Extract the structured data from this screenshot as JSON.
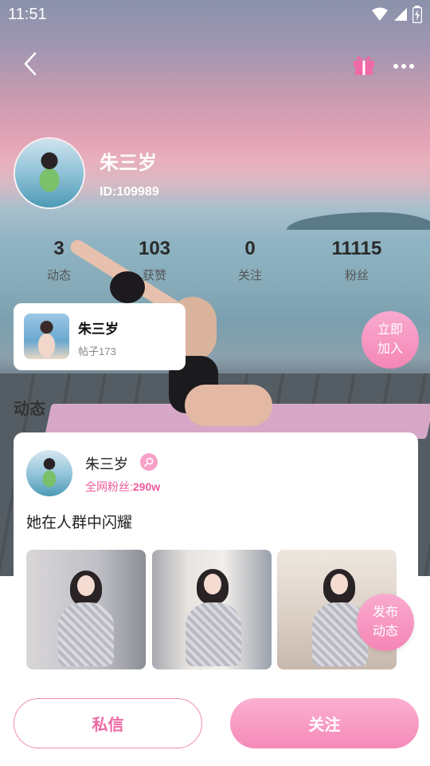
{
  "status_bar": {
    "time": "11:51"
  },
  "profile": {
    "name": "朱三岁",
    "id_text": "ID:109989"
  },
  "stats": [
    {
      "value": "3",
      "label": "动态"
    },
    {
      "value": "103",
      "label": "获赞"
    },
    {
      "value": "0",
      "label": "关注"
    },
    {
      "value": "11115",
      "label": "粉丝"
    }
  ],
  "circle": {
    "name": "朱三岁",
    "posts": "帖子173",
    "join_label_line1": "立即",
    "join_label_line2": "加入"
  },
  "section": {
    "title": "动态"
  },
  "post": {
    "author": "朱三岁",
    "fans_label": "全网粉丝:",
    "fans_value": "290w",
    "text": "她在人群中闪耀"
  },
  "publish": {
    "line1": "发布",
    "line2": "动态"
  },
  "actions": {
    "message_label": "私信",
    "follow_label": "关注"
  },
  "icons": {
    "back": "chevron-left-icon",
    "gift": "gift-icon",
    "more": "more-dots-icon",
    "gender": "female-icon",
    "wifi": "wifi-icon",
    "signal": "signal-icon",
    "battery": "battery-icon"
  },
  "colors": {
    "accent_pink": "#f586b6",
    "fans_pink": "#ee5c9a",
    "gift_pink": "#f06aa6"
  }
}
